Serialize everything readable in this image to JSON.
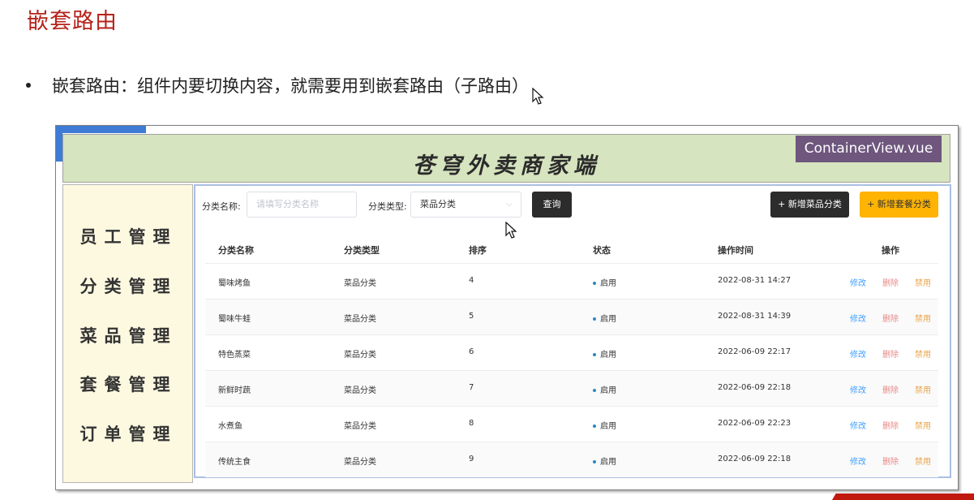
{
  "slide": {
    "title": "嵌套路由",
    "bullet": "嵌套路由：组件内要切换内容，就需要用到嵌套路由（子路由）"
  },
  "app": {
    "header_title": "苍穹外卖商家端",
    "badge": "ContainerView.vue",
    "sidebar": [
      {
        "label": "员工管理"
      },
      {
        "label": "分类管理"
      },
      {
        "label": "菜品管理"
      },
      {
        "label": "套餐管理"
      },
      {
        "label": "订单管理"
      }
    ],
    "search": {
      "name_label": "分类名称:",
      "name_placeholder": "请填写分类名称",
      "type_label": "分类类型:",
      "type_value": "菜品分类",
      "query_button": "查询"
    },
    "actions": {
      "add_dish_category": "+ 新增菜品分类",
      "add_setmeal_category": "+ 新增套餐分类"
    },
    "table": {
      "headers": [
        "分类名称",
        "分类类型",
        "排序",
        "状态",
        "操作时间",
        "操作"
      ],
      "rows": [
        {
          "name": "蜀味烤鱼",
          "type": "菜品分类",
          "sort": "4",
          "status": "启用",
          "time": "2022-08-31 14:27"
        },
        {
          "name": "蜀味牛蛙",
          "type": "菜品分类",
          "sort": "5",
          "status": "启用",
          "time": "2022-08-31 14:39"
        },
        {
          "name": "特色蒸菜",
          "type": "菜品分类",
          "sort": "6",
          "status": "启用",
          "time": "2022-06-09 22:17"
        },
        {
          "name": "新鲜时蔬",
          "type": "菜品分类",
          "sort": "7",
          "status": "启用",
          "time": "2022-06-09 22:18"
        },
        {
          "name": "水煮鱼",
          "type": "菜品分类",
          "sort": "8",
          "status": "启用",
          "time": "2022-06-09 22:23"
        },
        {
          "name": "传统主食",
          "type": "菜品分类",
          "sort": "9",
          "status": "启用",
          "time": "2022-06-09 22:18"
        }
      ],
      "ops": {
        "edit": "修改",
        "delete": "删除",
        "disable": "禁用"
      }
    }
  }
}
